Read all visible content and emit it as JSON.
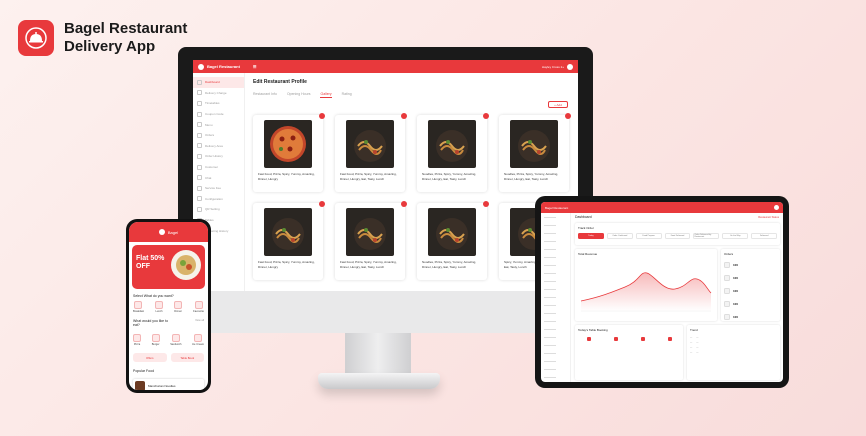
{
  "brand": {
    "title_line1": "Bagel Restaurant",
    "title_line2": "Delivery App",
    "accent": "#e8393c"
  },
  "desktop": {
    "app_name": "Bagel Restaurant",
    "user_label": "Hayley Cross 2+",
    "page_title": "Edit Restaurant Profile",
    "tabs": [
      {
        "label": "Restaurant Info"
      },
      {
        "label": "Opening Hours"
      },
      {
        "label": "Gallery",
        "active": true
      },
      {
        "label": "Rating"
      }
    ],
    "add_label": "+ Add",
    "sidebar": [
      {
        "label": "Dashboard",
        "active": true
      },
      {
        "label": "Delivery Charge"
      },
      {
        "label": "Timetables"
      },
      {
        "label": "Coupon Code"
      },
      {
        "label": "Menu"
      },
      {
        "label": "Orders"
      },
      {
        "label": "Delivery Area"
      },
      {
        "label": "Order History"
      },
      {
        "label": "Customer"
      },
      {
        "label": "Chat"
      },
      {
        "label": "Service Fee"
      },
      {
        "label": "Configuration"
      },
      {
        "label": "QR Setting"
      },
      {
        "label": "Tables"
      },
      {
        "label": "Marketing History"
      }
    ],
    "gallery": [
      {
        "desc": "Fast Food, Pizza, Spicy, Yummy, Amazing, Dinner, Hungry",
        "icon": "pizza-image"
      },
      {
        "desc": "Fast Food, Pizza, Spicy, Yummy, Amazing, Dinner, Hungry, Eat, Tasty, Lunch",
        "icon": "noodles-image"
      },
      {
        "desc": "Noodles, Pizza, Spicy, Yummy, Amazing, Dinner, Hungry, Eat, Tasty, Lunch",
        "icon": "noodles-image"
      },
      {
        "desc": "Noodles, Pizza, Spicy, Yummy, Amazing, Dinner, Hungry, Eat, Tasty, Lunch",
        "icon": "noodles-image"
      },
      {
        "desc": "Fast Food, Pizza, Spicy, Yummy, Amazing, Dinner, Hungry",
        "icon": "noodles-image"
      },
      {
        "desc": "Fast Food, Pizza, Spicy, Yummy, Amazing, Dinner, Hungry, Eat, Tasty, Lunch",
        "icon": "noodles-image"
      },
      {
        "desc": "Noodles, Pizza, Spicy, Yummy, Amazing, Dinner, Hungry, Eat, Tasty, Lunch",
        "icon": "noodles-image"
      },
      {
        "desc": "Spicy, Yummy, Amazing, Dinner, Hungry, Eat, Tasty, Lunch",
        "icon": "noodles-image"
      }
    ]
  },
  "phone": {
    "app_name": "Bagel",
    "promo": "Flat 50% OFF",
    "section1": "Select What do you want?",
    "section1_items": [
      "Breakfast",
      "Lunch",
      "Dinner",
      "Favourite"
    ],
    "section2": "What would you like to eat?",
    "view_all": "View all",
    "section2_items": [
      "Pizza",
      "Burger",
      "Sandwich",
      "Ice Cream"
    ],
    "offers": [
      "Offers",
      "Table Book"
    ],
    "popular_label": "Popular Food",
    "popular_item": "Manchurian Noodles"
  },
  "tablet": {
    "app_name": "Bagel Restaurant",
    "page_title": "Dashboard",
    "right_link": "Restaurant Status",
    "track_label": "Track Order",
    "filters": [
      "Today",
      "Order Confirmed",
      "Food Prepare",
      "Food Delivered",
      "Order Delivered by Restaurant",
      "On the Way",
      "Delivered"
    ],
    "revenue_label": "Total Revenue",
    "orders_label": "Orders",
    "order_stats": [
      "100",
      "100",
      "100",
      "100",
      "100"
    ],
    "booking_label": "Today's Table Booking",
    "trend_label": "Trend"
  }
}
